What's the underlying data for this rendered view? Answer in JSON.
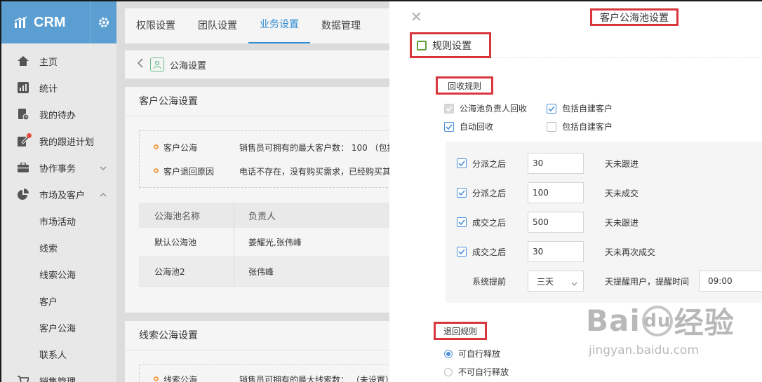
{
  "sidebar": {
    "brand": "CRM",
    "items": [
      {
        "label": "主页"
      },
      {
        "label": "统计"
      },
      {
        "label": "我的待办"
      },
      {
        "label": "我的跟进计划"
      },
      {
        "label": "协作事务"
      },
      {
        "label": "市场及客户"
      }
    ],
    "subitems": [
      "市场活动",
      "线索",
      "线索公海",
      "客户",
      "客户公海",
      "联系人"
    ],
    "last_item": "销售管理"
  },
  "topnav": {
    "tabs": [
      "权限设置",
      "团队设置",
      "业务设置",
      "数据管理"
    ],
    "active_tab": "业务设置"
  },
  "breadcrumb": {
    "label": "公海设置"
  },
  "customer_pool_panel": {
    "title": "客户公海设置",
    "info": [
      {
        "label": "客户公海",
        "value": "销售员可拥有的最大客户数： 100 （包括"
      },
      {
        "label": "客户退回原因",
        "value": "电话不存在，没有购买需求，已经购买其"
      }
    ],
    "table": {
      "headers": [
        "公海池名称",
        "负责人"
      ],
      "rows": [
        {
          "name": "默认公海池",
          "owner": "姜耀光,张伟峰"
        },
        {
          "name": "公海池2",
          "owner": "张伟峰"
        }
      ]
    }
  },
  "lead_pool_panel": {
    "title": "线索公海设置",
    "info": {
      "label": "线索公海",
      "value": "销售员可拥有的最大线索数： （未设置）"
    }
  },
  "drawer": {
    "title": "客户公海池设置",
    "section_title": "规则设置",
    "recycle": {
      "title": "回收规则",
      "checks": [
        {
          "label": "公海池负责人回收",
          "checked": true,
          "disabled": true
        },
        {
          "label": "包括自建客户",
          "checked": true
        },
        {
          "label": "自动回收",
          "checked": true
        },
        {
          "label": "包括自建客户",
          "checked": false
        }
      ],
      "rules": [
        {
          "label": "分派之后",
          "value": "30",
          "suffix": "天未跟进"
        },
        {
          "label": "分派之后",
          "value": "100",
          "suffix": "天未成交"
        },
        {
          "label": "成交之后",
          "value": "500",
          "suffix": "天未跟进"
        },
        {
          "label": "成交之后",
          "value": "30",
          "suffix": "天未再次成交"
        }
      ],
      "reminder": {
        "label": "系统提前",
        "value": "三天",
        "suffix": "天提醒用户，提醒时间",
        "time": "09:00"
      }
    },
    "return": {
      "title": "退回规则",
      "options": [
        {
          "label": "可自行释放",
          "selected": true
        },
        {
          "label": "不可自行释放",
          "selected": false
        }
      ]
    }
  },
  "watermark": {
    "brand": "Baidu经验",
    "url": "jingyan.baidu.com"
  },
  "colors": {
    "accent": "#2d8ad1",
    "brand_bar": "#5b9ed2",
    "highlight_box": "#d9363e"
  }
}
